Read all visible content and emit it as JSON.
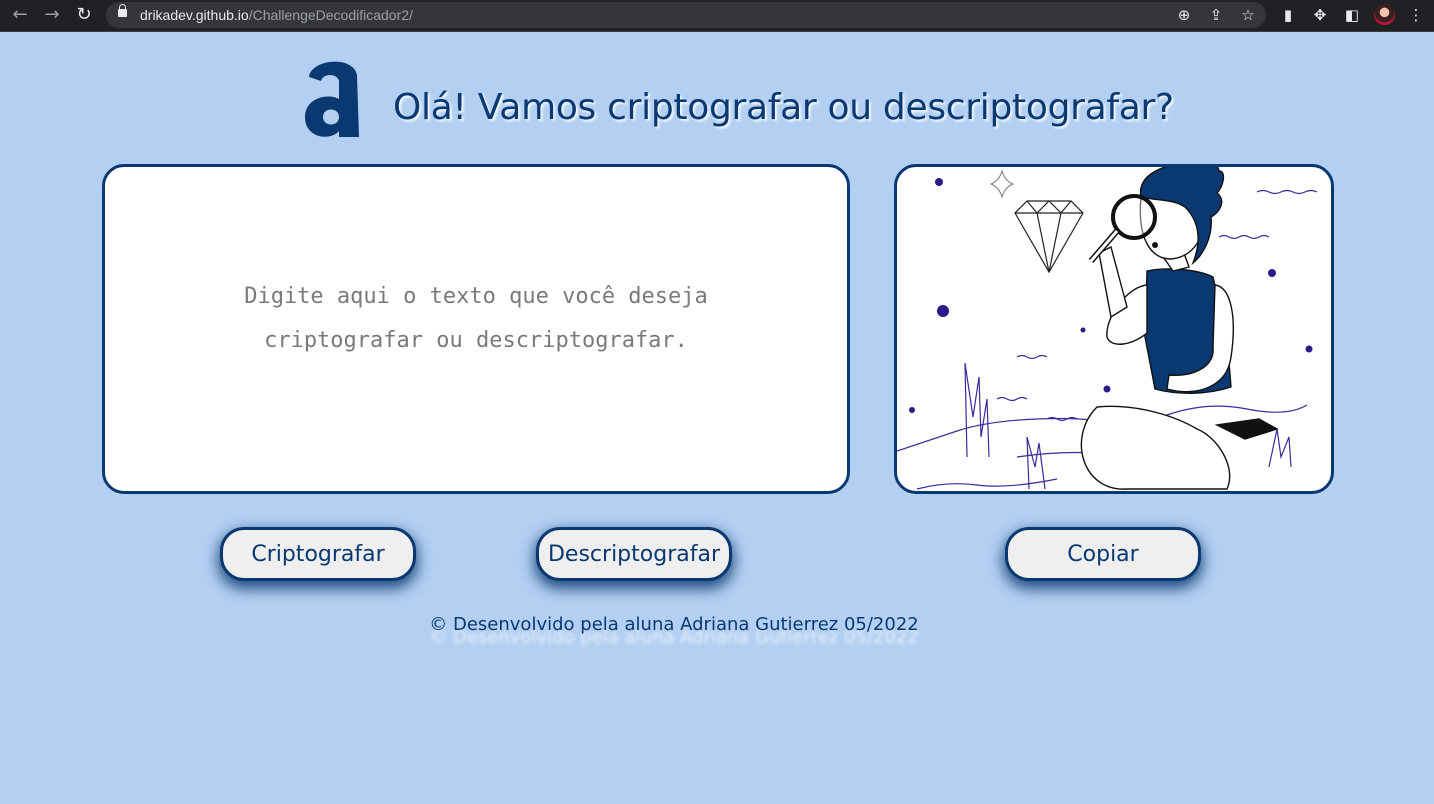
{
  "browser": {
    "url_host": "drikadev.github.io",
    "url_path": "/ChallengeDecodificador2/",
    "back_icon": "arrow-left",
    "forward_icon": "arrow-right",
    "reload_icon": "reload"
  },
  "header": {
    "title": "Olá! Vamos criptografar ou descriptografar?"
  },
  "input": {
    "placeholder": "Digite aqui o texto que você deseja criptografar ou descriptografar."
  },
  "buttons": {
    "encrypt_label": "Criptografar",
    "decrypt_label": "Descriptografar",
    "copy_label": "Copiar"
  },
  "footer": {
    "text": "© Desenvolvido pela aluna Adriana Gutierrez 05/2022"
  },
  "colors": {
    "background": "#b3d0f2",
    "primary": "#0a3871",
    "button_bg": "#efefef"
  }
}
